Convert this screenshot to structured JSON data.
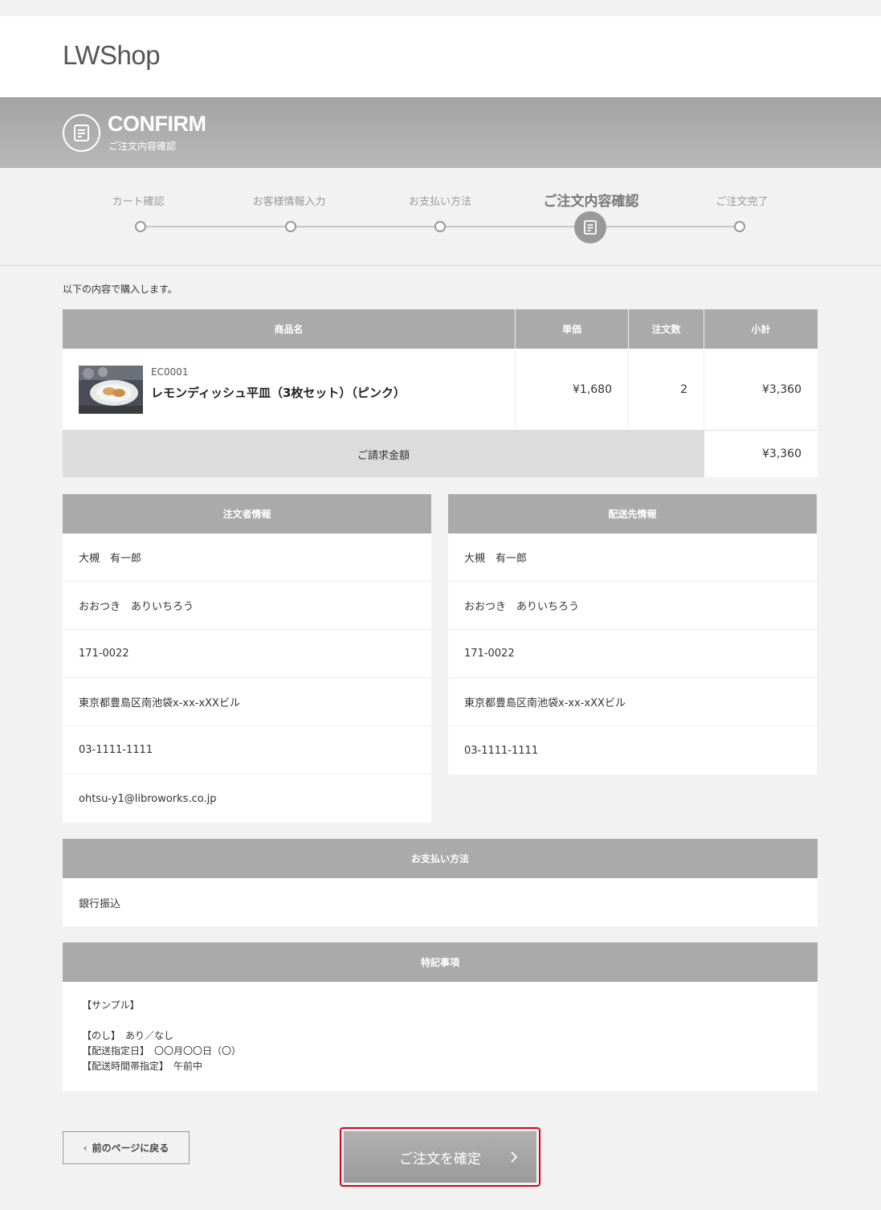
{
  "header": {
    "logo": "LWShop"
  },
  "banner": {
    "title": "CONFIRM",
    "subtitle": "ご注文内容確認",
    "icon": "document-icon"
  },
  "steps": [
    {
      "label": "カート確認",
      "active": false
    },
    {
      "label": "お客様情報入力",
      "active": false
    },
    {
      "label": "お支払い方法",
      "active": false
    },
    {
      "label": "ご注文内容確認",
      "active": true
    },
    {
      "label": "ご注文完了",
      "active": false
    }
  ],
  "intro": "以下の内容で購入します。",
  "order": {
    "headers": {
      "name": "商品名",
      "price": "単価",
      "qty": "注文数",
      "subtotal": "小計"
    },
    "item": {
      "code": "EC0001",
      "name": "レモンディッシュ平皿（3枚セット）（ピンク）",
      "price": "¥1,680",
      "qty": "2",
      "subtotal": "¥3,360"
    },
    "total_label": "ご請求金額",
    "total_value": "¥3,360"
  },
  "orderer": {
    "heading": "注文者情報",
    "rows": [
      "大槻　有一郎",
      "おおつき　ありいちろう",
      "171-0022",
      "東京都豊島区南池袋x-xx-xXXビル",
      "03-1111-1111",
      "ohtsu-y1@libroworks.co.jp"
    ]
  },
  "shipping": {
    "heading": "配送先情報",
    "rows": [
      "大槻　有一郎",
      "おおつき　ありいちろう",
      "171-0022",
      "東京都豊島区南池袋x-xx-xXXビル",
      "03-1111-1111"
    ]
  },
  "payment": {
    "heading": "お支払い方法",
    "value": "銀行振込"
  },
  "notes": {
    "heading": "特記事項",
    "lines": [
      "【サンプル】",
      "",
      "【のし】　あり／なし",
      "【配送指定日】　〇〇月〇〇日（〇）",
      "【配送時間帯指定】　午前中"
    ]
  },
  "buttons": {
    "back": "前のページに戻る",
    "confirm": "ご注文を確定"
  }
}
